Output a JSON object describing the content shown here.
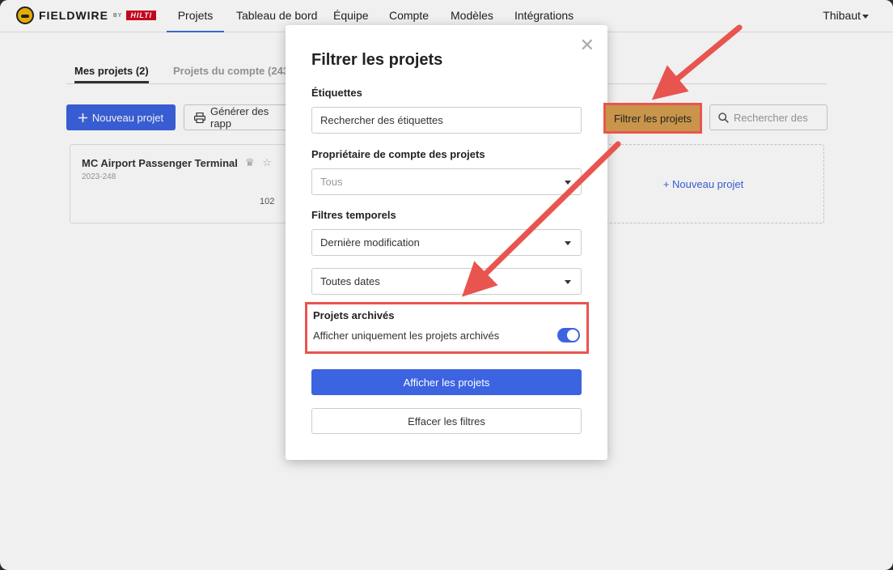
{
  "brand": {
    "name": "FIELDWIRE",
    "by": "BY",
    "partner": "HILTI"
  },
  "nav": {
    "items": [
      {
        "label": "Projets",
        "active": true
      },
      {
        "label": "Tableau de bord"
      },
      {
        "label": "Équipe"
      },
      {
        "label": "Compte"
      },
      {
        "label": "Modèles"
      },
      {
        "label": "Intégrations"
      }
    ],
    "user": "Thibaut"
  },
  "tabs": {
    "mine": "Mes projets (2)",
    "account": "Projets du compte (2439"
  },
  "toolbar": {
    "new_project": "Nouveau projet",
    "reports": "Générer des rapp",
    "filter": "Filtrer les projets",
    "search_placeholder": "Rechercher des"
  },
  "project_card": {
    "title": "MC Airport Passenger Terminal",
    "code": "2023-248",
    "count": "102"
  },
  "new_card_label": "+ Nouveau projet",
  "modal": {
    "title": "Filtrer les projets",
    "tags_label": "Étiquettes",
    "tags_placeholder": "Rechercher des étiquettes",
    "owner_label": "Propriétaire de compte des projets",
    "owner_value": "Tous",
    "time_label": "Filtres temporels",
    "time_modified": "Dernière modification",
    "time_dates": "Toutes dates",
    "archived_label": "Projets archivés",
    "archived_text": "Afficher uniquement les projets archivés",
    "archived_on": true,
    "show_button": "Afficher les projets",
    "clear_button": "Effacer les filtres"
  },
  "colors": {
    "accent": "#3c63e0",
    "annotation": "#e8554f",
    "highlight": "#c9954b"
  }
}
